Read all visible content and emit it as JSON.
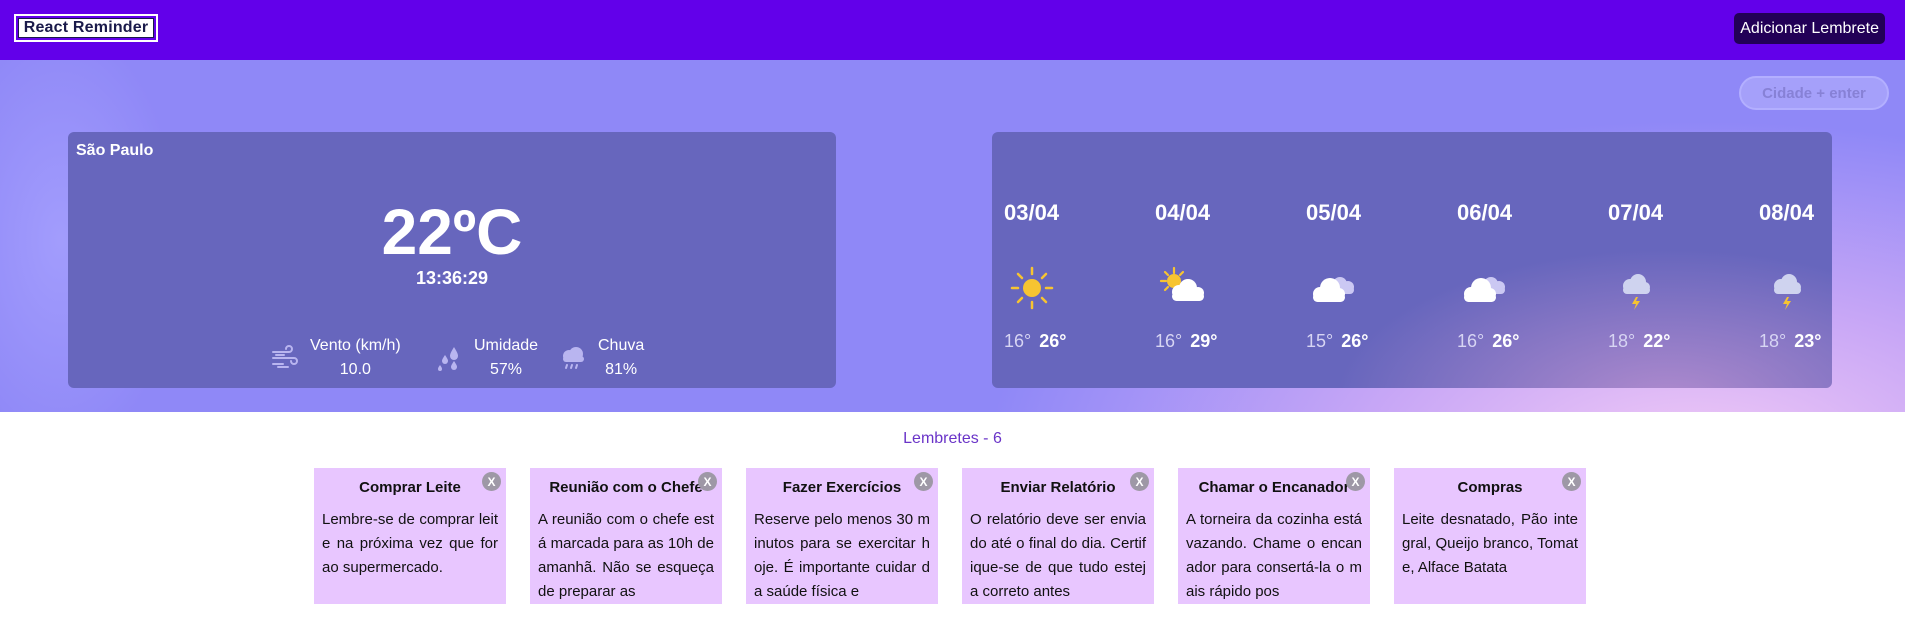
{
  "header": {
    "logo_text": "React Reminder",
    "add_button_label": "Adicionar Lembrete"
  },
  "search": {
    "placeholder": "Cidade + enter"
  },
  "current_weather": {
    "city": "São Paulo",
    "temperature": "22ºC",
    "time": "13:36:29",
    "stats": [
      {
        "label": "Vento (km/h)",
        "value": "10.0",
        "icon": "wind-icon"
      },
      {
        "label": "Umidade",
        "value": "57%",
        "icon": "humidity-icon"
      },
      {
        "label": "Chuva",
        "value": "81%",
        "icon": "rain-cloud-icon"
      }
    ]
  },
  "forecast": [
    {
      "date": "03/04",
      "min": "16°",
      "max": "26°",
      "icon": "sun-icon"
    },
    {
      "date": "04/04",
      "min": "16°",
      "max": "29°",
      "icon": "partly-cloudy-icon"
    },
    {
      "date": "05/04",
      "min": "15°",
      "max": "26°",
      "icon": "cloudy-icon"
    },
    {
      "date": "06/04",
      "min": "16°",
      "max": "26°",
      "icon": "cloudy-icon"
    },
    {
      "date": "07/04",
      "min": "18°",
      "max": "22°",
      "icon": "thunderstorm-icon"
    },
    {
      "date": "08/04",
      "min": "18°",
      "max": "23°",
      "icon": "thunderstorm-icon"
    }
  ],
  "reminders": {
    "title": "Lembretes - 6",
    "items": [
      {
        "title": "Comprar Leite",
        "body": "Lembre-se de comprar leite na próxima vez que for ao supermercado.",
        "close": "X"
      },
      {
        "title": "Reunião com o Chefe",
        "body": "A reunião com o chefe está marcada para as 10h de amanhã. Não se esqueça de preparar as",
        "close": "X"
      },
      {
        "title": "Fazer Exercícios",
        "body": "Reserve pelo menos 30 minutos para se exercitar hoje. É importante cuidar da saúde física e",
        "close": "X"
      },
      {
        "title": "Enviar Relatório",
        "body": "O relatório deve ser enviado até o final do dia. Certifique-se de que tudo esteja correto antes",
        "close": "X"
      },
      {
        "title": "Chamar o Encanador",
        "body": "A torneira da cozinha está vazando. Chame o encanador para consertá-la o mais rápido pos",
        "close": "X"
      },
      {
        "title": "Compras",
        "body": "Leite desnatado, Pão integral, Queijo branco, Tomate, Alface Batata",
        "close": "X"
      }
    ]
  },
  "colors": {
    "topbar": "#6200ea",
    "band": "#8f88f7",
    "card": "#6766bd",
    "reminder_card": "#e8c6ff",
    "sun": "#f7c431"
  }
}
